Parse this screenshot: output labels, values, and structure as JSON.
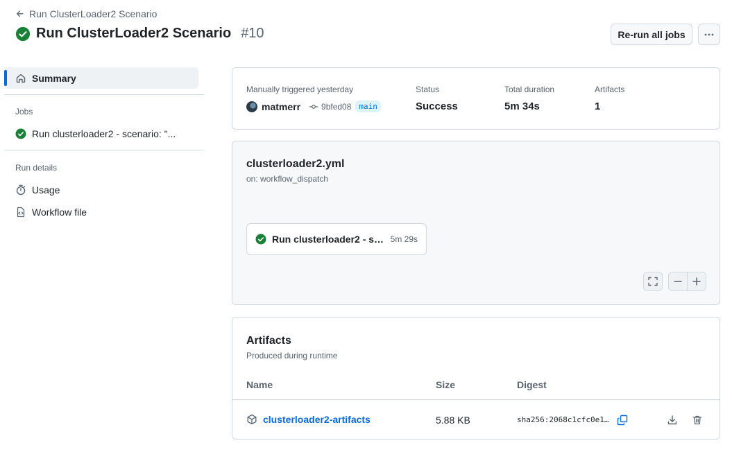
{
  "header": {
    "back_label": "Run ClusterLoader2 Scenario",
    "title": "Run ClusterLoader2 Scenario",
    "run_number": "#10",
    "rerun_label": "Re-run all jobs"
  },
  "sidebar": {
    "summary_label": "Summary",
    "jobs_heading": "Jobs",
    "jobs": [
      {
        "label": "Run clusterloader2 - scenario: \"..."
      }
    ],
    "run_details_heading": "Run details",
    "details": [
      {
        "label": "Usage",
        "icon": "stopwatch-icon"
      },
      {
        "label": "Workflow file",
        "icon": "file-code-icon"
      }
    ]
  },
  "summary": {
    "trigger_label": "Manually triggered yesterday",
    "actor": "matmerr",
    "commit": "9bfed08",
    "branch": "main",
    "status_label": "Status",
    "status_value": "Success",
    "duration_label": "Total duration",
    "duration_value": "5m 34s",
    "artifacts_label": "Artifacts",
    "artifacts_value": "1"
  },
  "workflow": {
    "file_name": "clusterloader2.yml",
    "trigger": "on: workflow_dispatch",
    "job_name": "Run clusterloader2 - sce...",
    "job_duration": "5m 29s"
  },
  "artifacts": {
    "title": "Artifacts",
    "subtitle": "Produced during runtime",
    "columns": {
      "name": "Name",
      "size": "Size",
      "digest": "Digest"
    },
    "rows": [
      {
        "name": "clusterloader2-artifacts",
        "size": "5.88 KB",
        "digest": "sha256:2068c1cfc0e1…"
      }
    ]
  },
  "colors": {
    "success": "#1a7f37",
    "accent": "#0969da",
    "muted": "#59636e",
    "border": "#d1d9e0"
  }
}
